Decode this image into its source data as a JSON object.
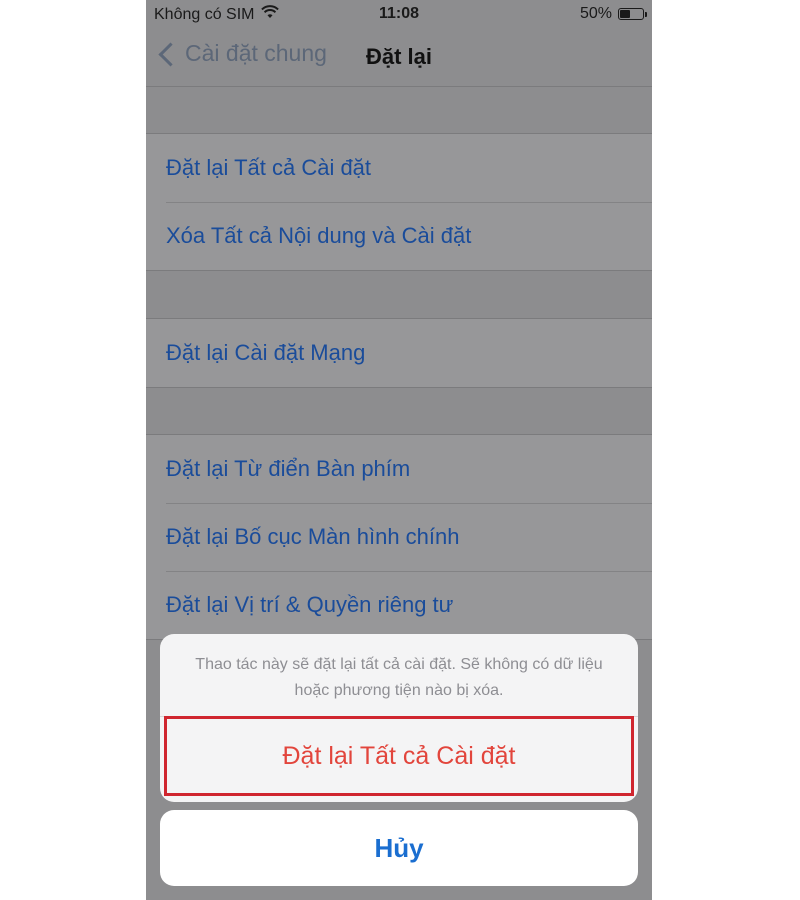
{
  "status_bar": {
    "carrier": "Không có SIM",
    "time": "11:08",
    "battery": "50%",
    "battery_level": 0.5,
    "wifi_icon": "wifi-icon"
  },
  "nav": {
    "back_label": "Cài đặt chung",
    "title": "Đặt lại"
  },
  "groups": [
    {
      "items": [
        "Đặt lại Tất cả Cài đặt",
        "Xóa Tất cả Nội dung và Cài đặt"
      ]
    },
    {
      "items": [
        "Đặt lại Cài đặt Mạng"
      ]
    },
    {
      "items": [
        "Đặt lại Từ điển Bàn phím",
        "Đặt lại Bố cục Màn hình chính",
        "Đặt lại Vị trí & Quyền riêng tư"
      ]
    }
  ],
  "action_sheet": {
    "message": "Thao tác này sẽ đặt lại tất cả cài đặt. Sẽ không có dữ liệu hoặc phương tiện nào bị xóa.",
    "destructive_label": "Đặt lại Tất cả Cài đặt",
    "cancel_label": "Hủy"
  },
  "colors": {
    "link": "#1a4c9a",
    "destructive": "#e2453c",
    "highlight_border": "#d0262f",
    "cancel": "#1a6ed0"
  }
}
